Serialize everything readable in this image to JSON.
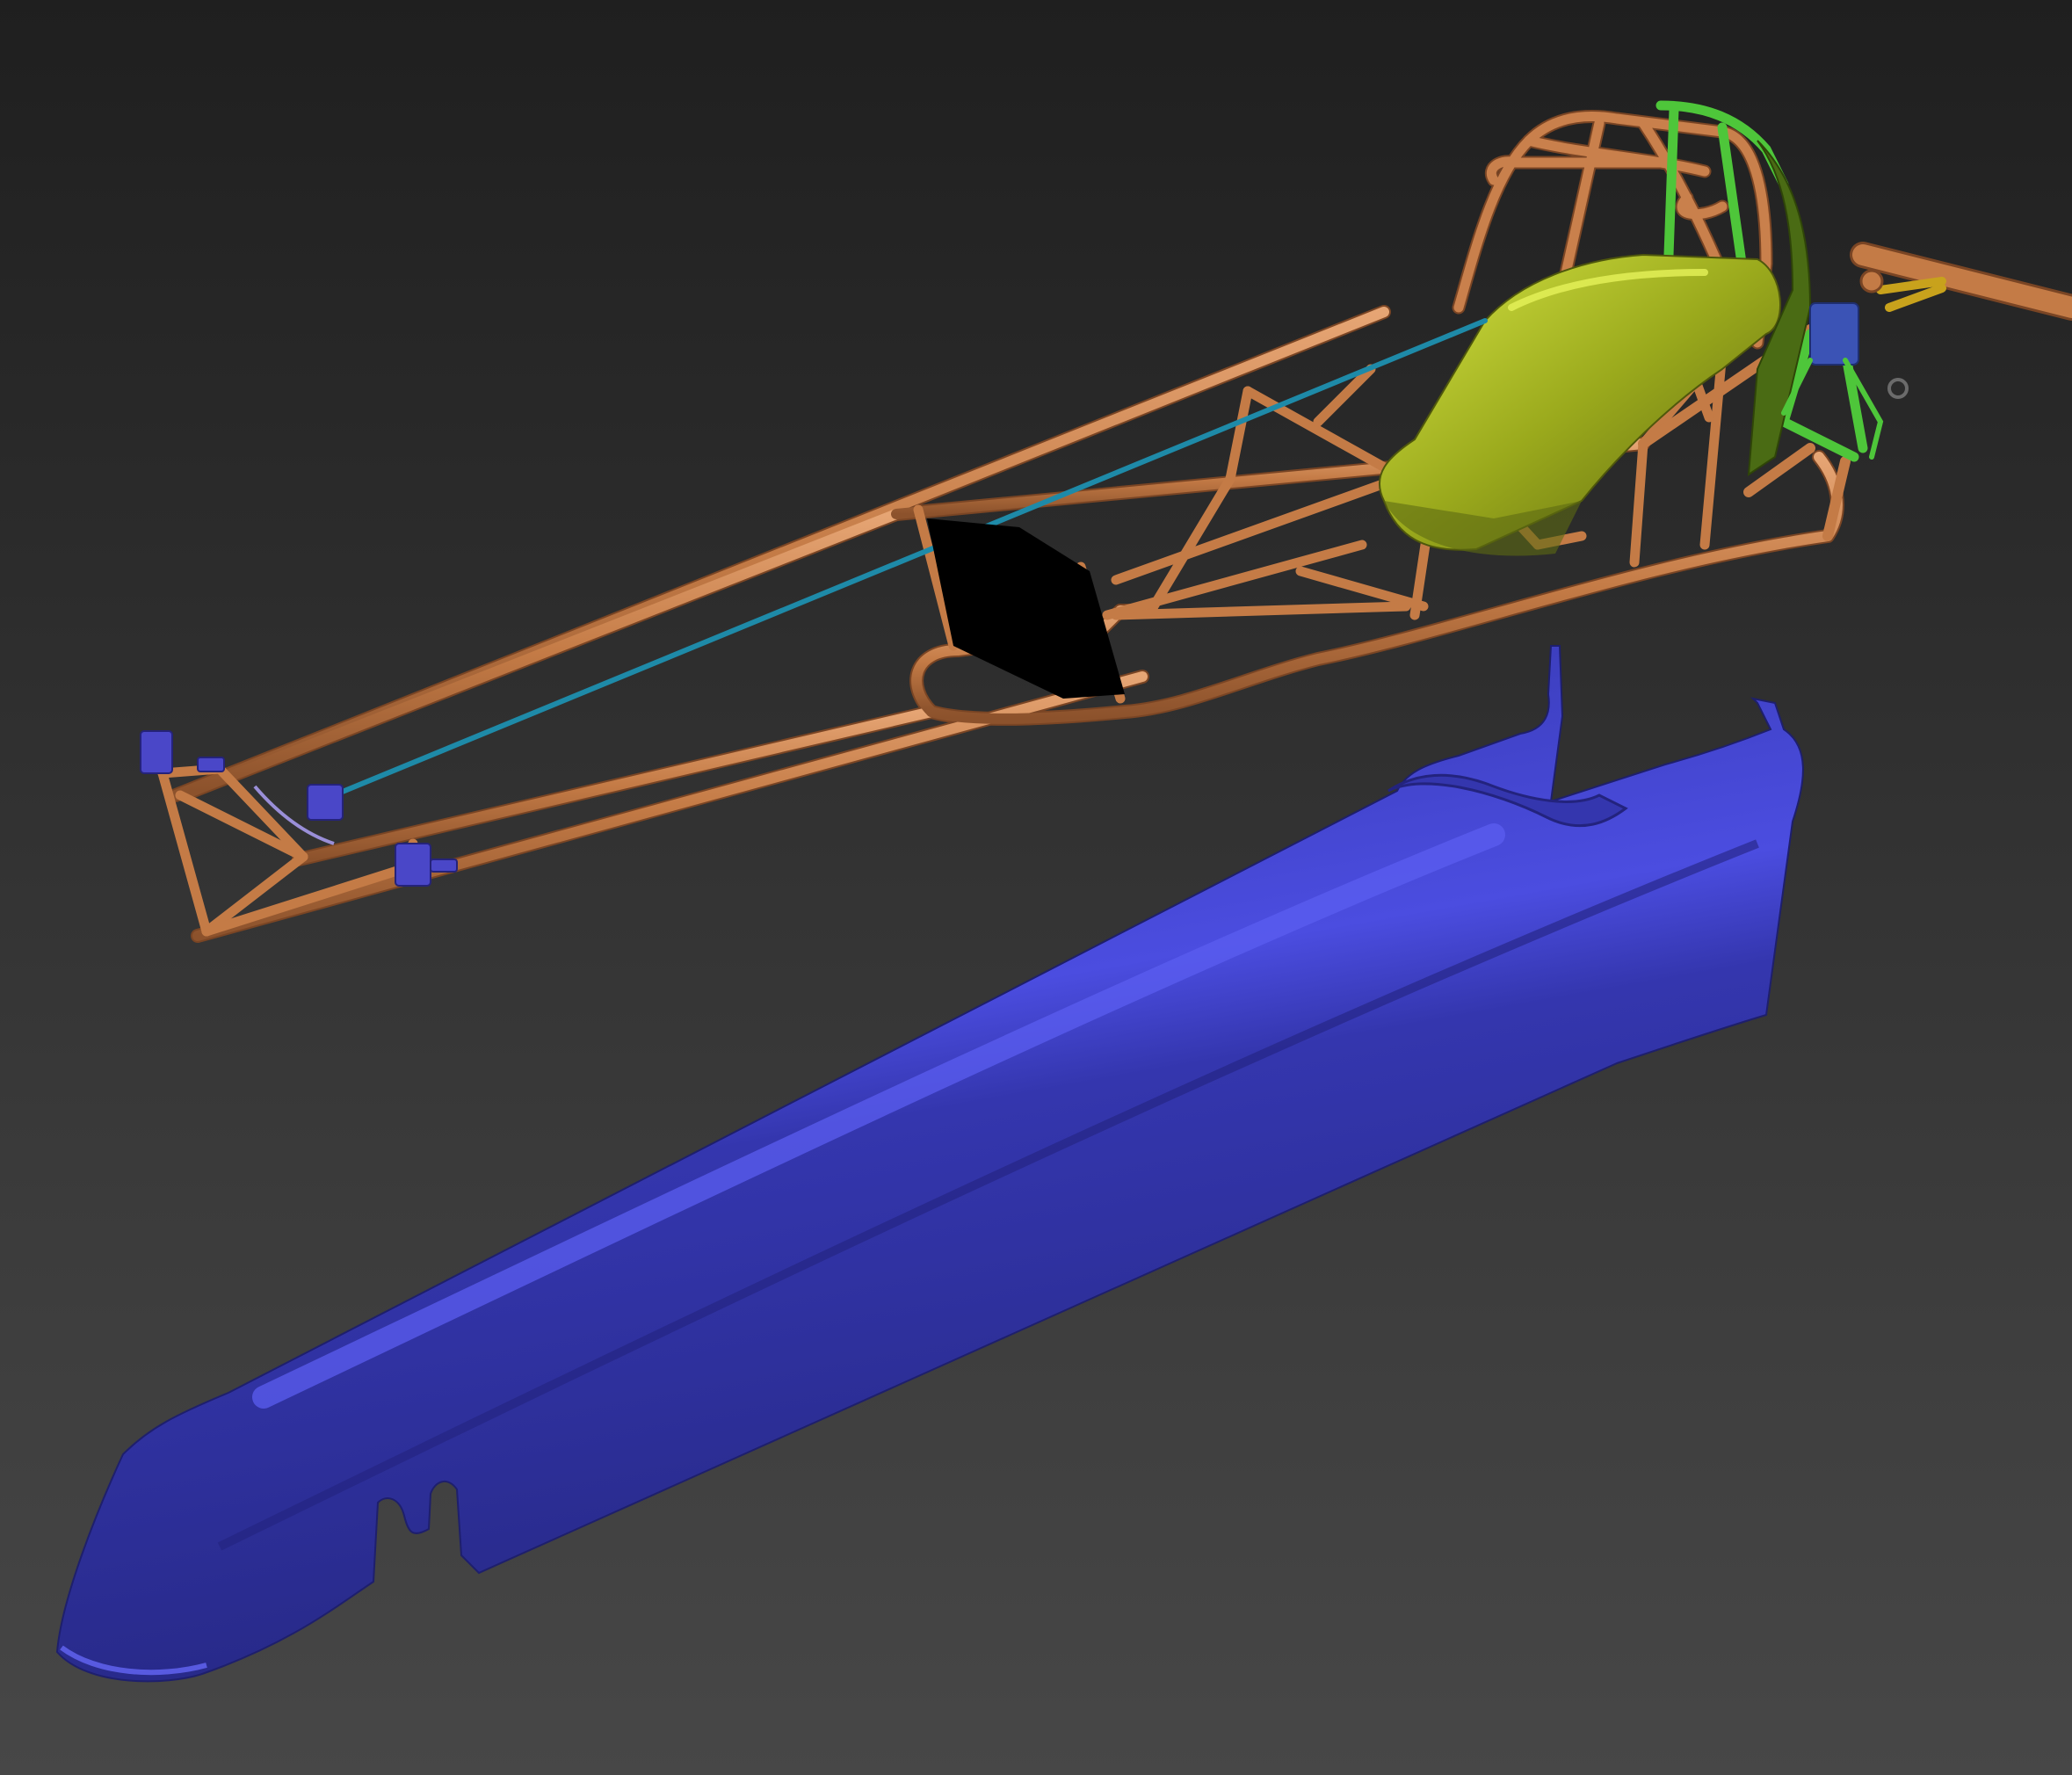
{
  "viewport": {
    "background_top": "#1f1f1f",
    "background_bottom": "#474747"
  },
  "materials": {
    "frame_tube": "#c9804c",
    "frame_shadow": "#8a4f2a",
    "frame_highlight": "#e8a978",
    "seat": "#9fae1f",
    "seat_highlight": "#d9e84a",
    "roll_bar_green": "#4ec63a",
    "steering_rod": "#1e8aa8",
    "fitting_blue": "#4a47c8",
    "axle_yellow": "#c8a21c",
    "body_shell": "#3d3fc4",
    "body_shell_highlight": "#5b5ef0",
    "body_shell_dark": "#23237e",
    "panel_black": "#000000"
  },
  "objects": [
    {
      "name": "dragster-chassis-frame",
      "material": "frame_tube"
    },
    {
      "name": "roll-cage",
      "material": "frame_tube"
    },
    {
      "name": "driver-seat",
      "material": "seat"
    },
    {
      "name": "steering-rod",
      "material": "steering_rod"
    },
    {
      "name": "front-axle-fittings",
      "material": "fitting_blue"
    },
    {
      "name": "rear-axle",
      "material": "axle_yellow"
    },
    {
      "name": "body-shell",
      "material": "body_shell"
    }
  ]
}
